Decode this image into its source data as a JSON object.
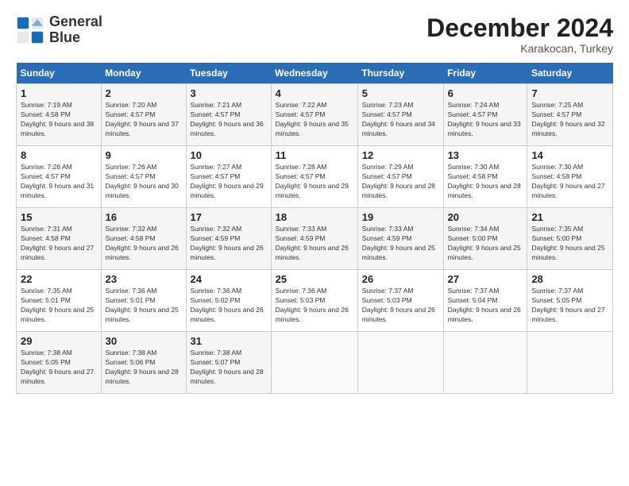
{
  "logo": {
    "line1": "General",
    "line2": "Blue"
  },
  "title": "December 2024",
  "subtitle": "Karakocan, Turkey",
  "header": {
    "days": [
      "Sunday",
      "Monday",
      "Tuesday",
      "Wednesday",
      "Thursday",
      "Friday",
      "Saturday"
    ]
  },
  "weeks": [
    [
      {
        "num": "1",
        "sunrise": "Sunrise: 7:19 AM",
        "sunset": "Sunset: 4:58 PM",
        "daylight": "Daylight: 9 hours and 38 minutes."
      },
      {
        "num": "2",
        "sunrise": "Sunrise: 7:20 AM",
        "sunset": "Sunset: 4:57 PM",
        "daylight": "Daylight: 9 hours and 37 minutes."
      },
      {
        "num": "3",
        "sunrise": "Sunrise: 7:21 AM",
        "sunset": "Sunset: 4:57 PM",
        "daylight": "Daylight: 9 hours and 36 minutes."
      },
      {
        "num": "4",
        "sunrise": "Sunrise: 7:22 AM",
        "sunset": "Sunset: 4:57 PM",
        "daylight": "Daylight: 9 hours and 35 minutes."
      },
      {
        "num": "5",
        "sunrise": "Sunrise: 7:23 AM",
        "sunset": "Sunset: 4:57 PM",
        "daylight": "Daylight: 9 hours and 34 minutes."
      },
      {
        "num": "6",
        "sunrise": "Sunrise: 7:24 AM",
        "sunset": "Sunset: 4:57 PM",
        "daylight": "Daylight: 9 hours and 33 minutes."
      },
      {
        "num": "7",
        "sunrise": "Sunrise: 7:25 AM",
        "sunset": "Sunset: 4:57 PM",
        "daylight": "Daylight: 9 hours and 32 minutes."
      }
    ],
    [
      {
        "num": "8",
        "sunrise": "Sunrise: 7:26 AM",
        "sunset": "Sunset: 4:57 PM",
        "daylight": "Daylight: 9 hours and 31 minutes."
      },
      {
        "num": "9",
        "sunrise": "Sunrise: 7:26 AM",
        "sunset": "Sunset: 4:57 PM",
        "daylight": "Daylight: 9 hours and 30 minutes."
      },
      {
        "num": "10",
        "sunrise": "Sunrise: 7:27 AM",
        "sunset": "Sunset: 4:57 PM",
        "daylight": "Daylight: 9 hours and 29 minutes."
      },
      {
        "num": "11",
        "sunrise": "Sunrise: 7:28 AM",
        "sunset": "Sunset: 4:57 PM",
        "daylight": "Daylight: 9 hours and 29 minutes."
      },
      {
        "num": "12",
        "sunrise": "Sunrise: 7:29 AM",
        "sunset": "Sunset: 4:57 PM",
        "daylight": "Daylight: 9 hours and 28 minutes."
      },
      {
        "num": "13",
        "sunrise": "Sunrise: 7:30 AM",
        "sunset": "Sunset: 4:58 PM",
        "daylight": "Daylight: 9 hours and 28 minutes."
      },
      {
        "num": "14",
        "sunrise": "Sunrise: 7:30 AM",
        "sunset": "Sunset: 4:58 PM",
        "daylight": "Daylight: 9 hours and 27 minutes."
      }
    ],
    [
      {
        "num": "15",
        "sunrise": "Sunrise: 7:31 AM",
        "sunset": "Sunset: 4:58 PM",
        "daylight": "Daylight: 9 hours and 27 minutes."
      },
      {
        "num": "16",
        "sunrise": "Sunrise: 7:32 AM",
        "sunset": "Sunset: 4:58 PM",
        "daylight": "Daylight: 9 hours and 26 minutes."
      },
      {
        "num": "17",
        "sunrise": "Sunrise: 7:32 AM",
        "sunset": "Sunset: 4:59 PM",
        "daylight": "Daylight: 9 hours and 26 minutes."
      },
      {
        "num": "18",
        "sunrise": "Sunrise: 7:33 AM",
        "sunset": "Sunset: 4:59 PM",
        "daylight": "Daylight: 9 hours and 26 minutes."
      },
      {
        "num": "19",
        "sunrise": "Sunrise: 7:33 AM",
        "sunset": "Sunset: 4:59 PM",
        "daylight": "Daylight: 9 hours and 25 minutes."
      },
      {
        "num": "20",
        "sunrise": "Sunrise: 7:34 AM",
        "sunset": "Sunset: 5:00 PM",
        "daylight": "Daylight: 9 hours and 25 minutes."
      },
      {
        "num": "21",
        "sunrise": "Sunrise: 7:35 AM",
        "sunset": "Sunset: 5:00 PM",
        "daylight": "Daylight: 9 hours and 25 minutes."
      }
    ],
    [
      {
        "num": "22",
        "sunrise": "Sunrise: 7:35 AM",
        "sunset": "Sunset: 5:01 PM",
        "daylight": "Daylight: 9 hours and 25 minutes."
      },
      {
        "num": "23",
        "sunrise": "Sunrise: 7:36 AM",
        "sunset": "Sunset: 5:01 PM",
        "daylight": "Daylight: 9 hours and 25 minutes."
      },
      {
        "num": "24",
        "sunrise": "Sunrise: 7:36 AM",
        "sunset": "Sunset: 5:02 PM",
        "daylight": "Daylight: 9 hours and 26 minutes."
      },
      {
        "num": "25",
        "sunrise": "Sunrise: 7:36 AM",
        "sunset": "Sunset: 5:03 PM",
        "daylight": "Daylight: 9 hours and 26 minutes."
      },
      {
        "num": "26",
        "sunrise": "Sunrise: 7:37 AM",
        "sunset": "Sunset: 5:03 PM",
        "daylight": "Daylight: 9 hours and 26 minutes."
      },
      {
        "num": "27",
        "sunrise": "Sunrise: 7:37 AM",
        "sunset": "Sunset: 5:04 PM",
        "daylight": "Daylight: 9 hours and 26 minutes."
      },
      {
        "num": "28",
        "sunrise": "Sunrise: 7:37 AM",
        "sunset": "Sunset: 5:05 PM",
        "daylight": "Daylight: 9 hours and 27 minutes."
      }
    ],
    [
      {
        "num": "29",
        "sunrise": "Sunrise: 7:38 AM",
        "sunset": "Sunset: 5:05 PM",
        "daylight": "Daylight: 9 hours and 27 minutes."
      },
      {
        "num": "30",
        "sunrise": "Sunrise: 7:38 AM",
        "sunset": "Sunset: 5:06 PM",
        "daylight": "Daylight: 9 hours and 28 minutes."
      },
      {
        "num": "31",
        "sunrise": "Sunrise: 7:38 AM",
        "sunset": "Sunset: 5:07 PM",
        "daylight": "Daylight: 9 hours and 28 minutes."
      },
      null,
      null,
      null,
      null
    ]
  ]
}
